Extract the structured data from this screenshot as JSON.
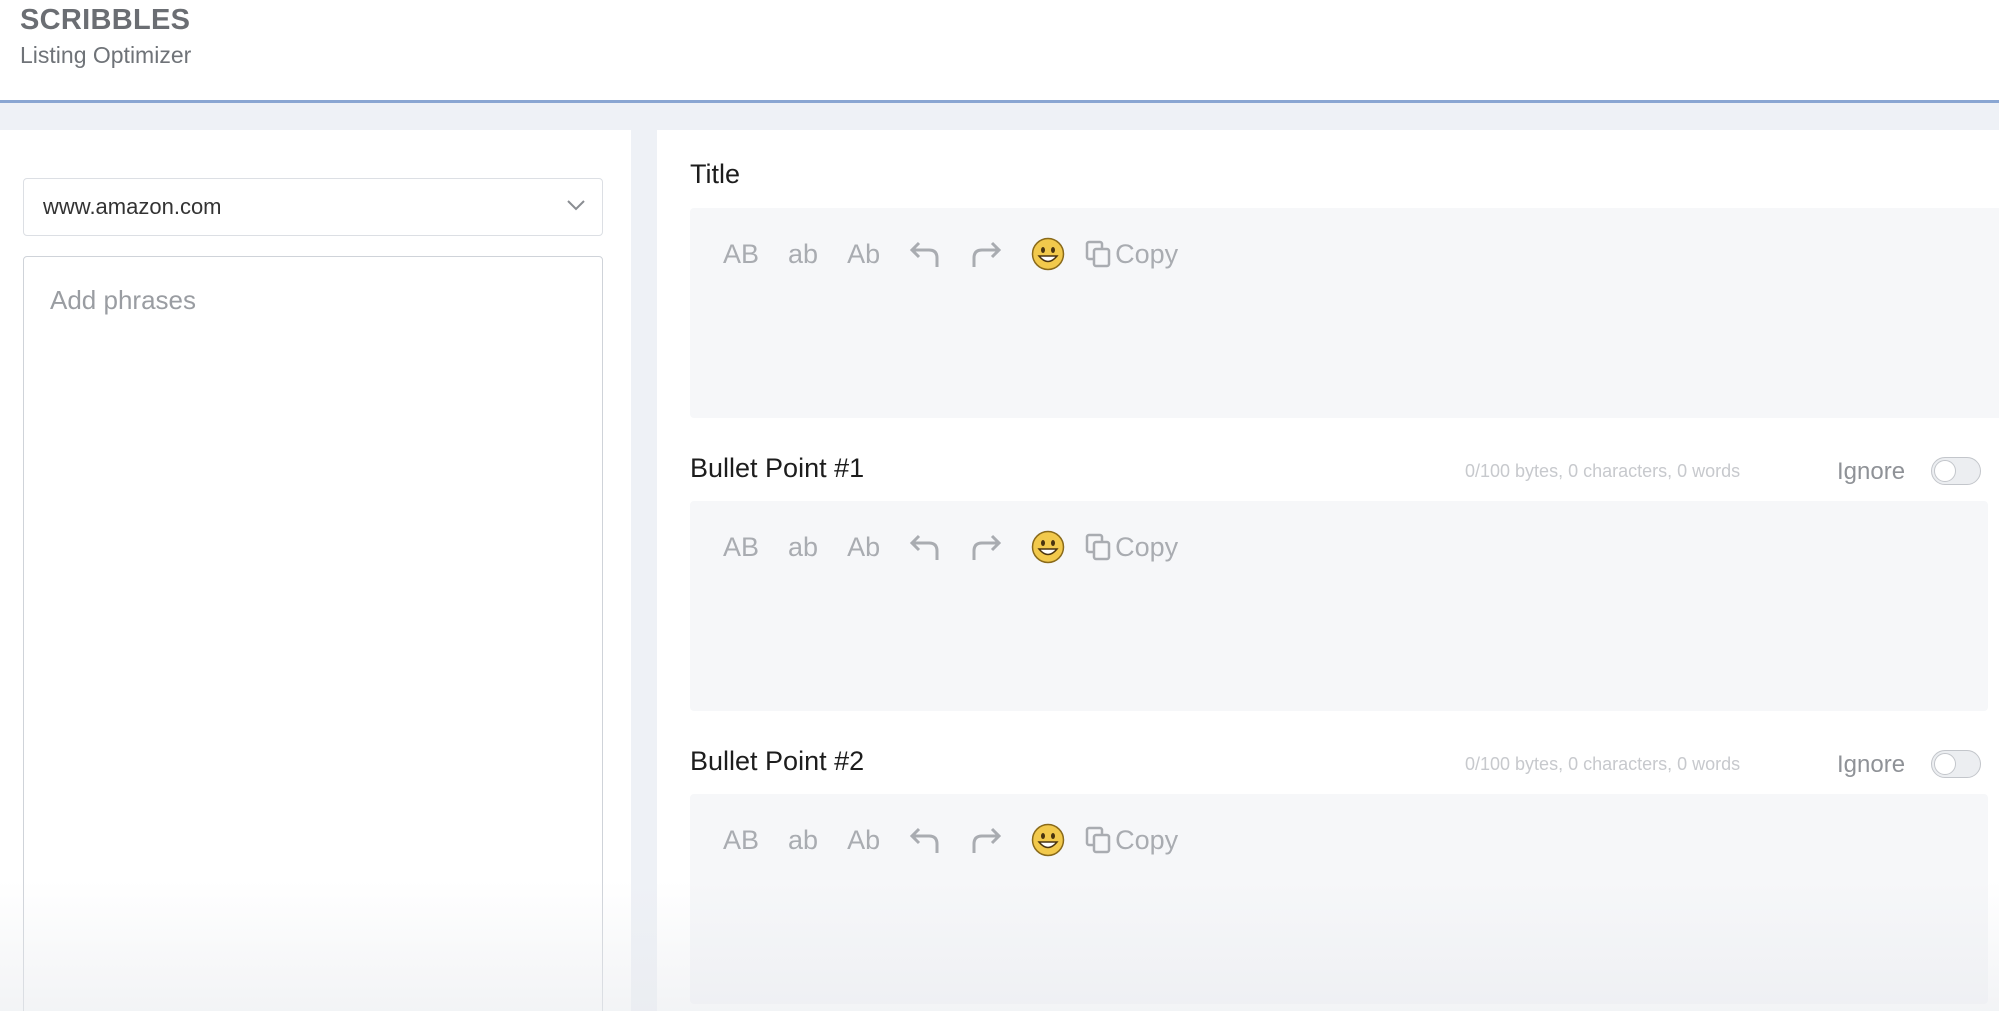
{
  "app": {
    "brand": "SCRIBBLES",
    "subtitle": "Listing Optimizer"
  },
  "left": {
    "marketplace": {
      "selected": "www.amazon.com"
    },
    "phrases": {
      "placeholder": "Add phrases"
    }
  },
  "toolbar": {
    "uppercase": "AB",
    "lowercase": "ab",
    "titlecase": "Ab",
    "copy_label": "Copy",
    "icons": [
      "undo-icon",
      "redo-icon",
      "emoji-icon",
      "copy-icon"
    ]
  },
  "sections": [
    {
      "label": "Title"
    },
    {
      "label": "Bullet Point #1",
      "meta": "0/100 bytes, 0 characters, 0 words",
      "ignore_label": "Ignore",
      "ignore_on": false
    },
    {
      "label": "Bullet Point #2",
      "meta": "0/100 bytes, 0 characters, 0 words",
      "ignore_label": "Ignore",
      "ignore_on": false
    }
  ],
  "colors": {
    "header_border": "#8aa6d2",
    "editor_bg": "#f6f7f9",
    "emoji": "#f2c94c"
  }
}
